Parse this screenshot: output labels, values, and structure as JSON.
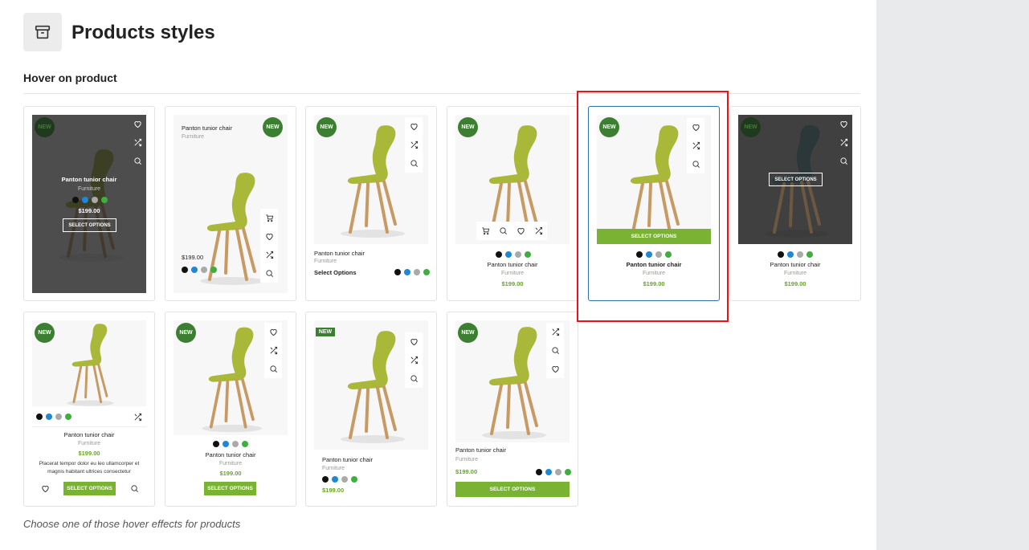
{
  "header": {
    "title": "Products styles",
    "icon": "archive-icon"
  },
  "section": {
    "subtitle": "Hover on product",
    "note": "Choose one of those hover effects for products"
  },
  "product": {
    "name": "Panton tunior chair",
    "category": "Furniture",
    "price": "$199.00",
    "badge": "NEW"
  },
  "buttons": {
    "select_options_upper": "SELECT OPTIONS",
    "select_options": "Select Options"
  },
  "description": "Placerat tempor dolor eu leo ullamcorper et magnis habitant ultrices consectetur",
  "swatches": [
    "#111111",
    "#1e88d8",
    "#aaaaaa",
    "#3daf3d"
  ],
  "colors": {
    "accent": "#7ab234",
    "badge": "#3d7f32",
    "price": "#6aa32c",
    "highlight": "#e8131b",
    "active_border": "#2c6fb0"
  }
}
